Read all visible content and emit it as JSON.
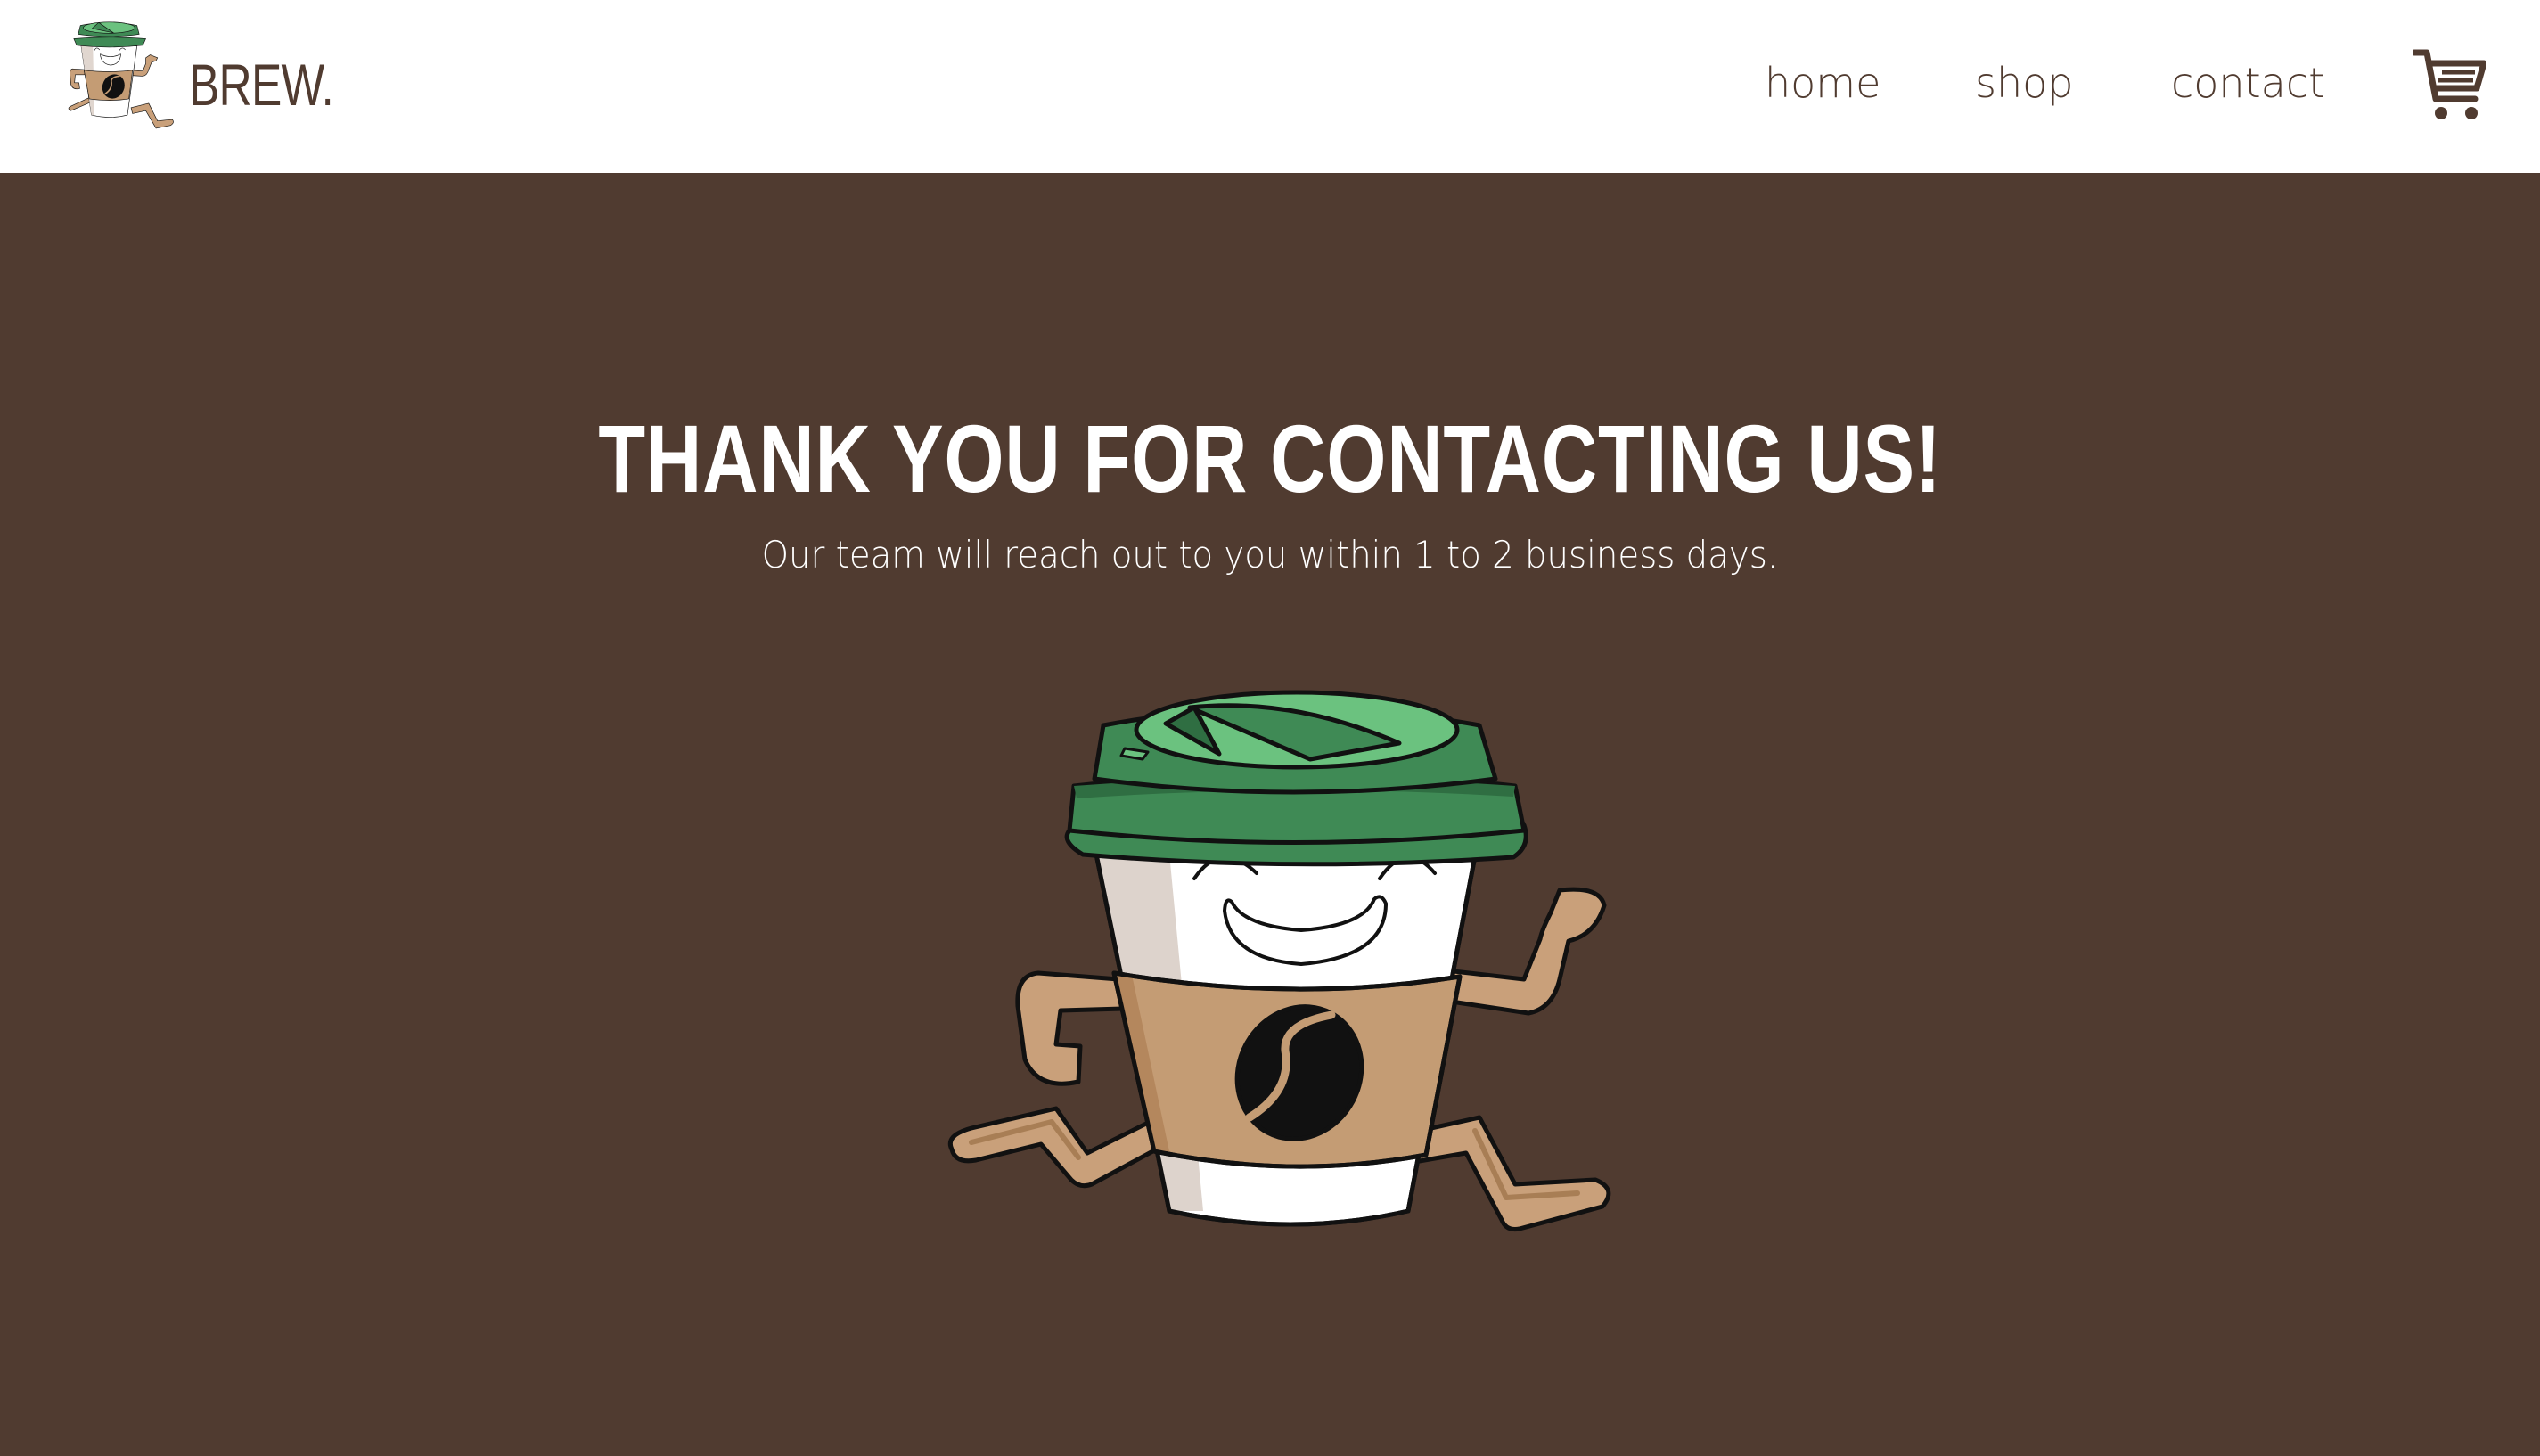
{
  "header": {
    "brand": "BREW.",
    "nav": [
      {
        "label": "home"
      },
      {
        "label": "shop"
      },
      {
        "label": "contact"
      }
    ],
    "cart_icon": "cart-icon"
  },
  "hero": {
    "title": "THANK YOU FOR CONTACTING US!",
    "subtitle": "Our team will reach out to you within 1 to 2 business days."
  },
  "colors": {
    "background": "#503b30",
    "header_bg": "#ffffff",
    "text_dark": "#503b30",
    "lid_green": "#3f8a55",
    "lid_light": "#6bc27f",
    "sleeve": "#c49c74",
    "limb": "#c9a07a"
  }
}
